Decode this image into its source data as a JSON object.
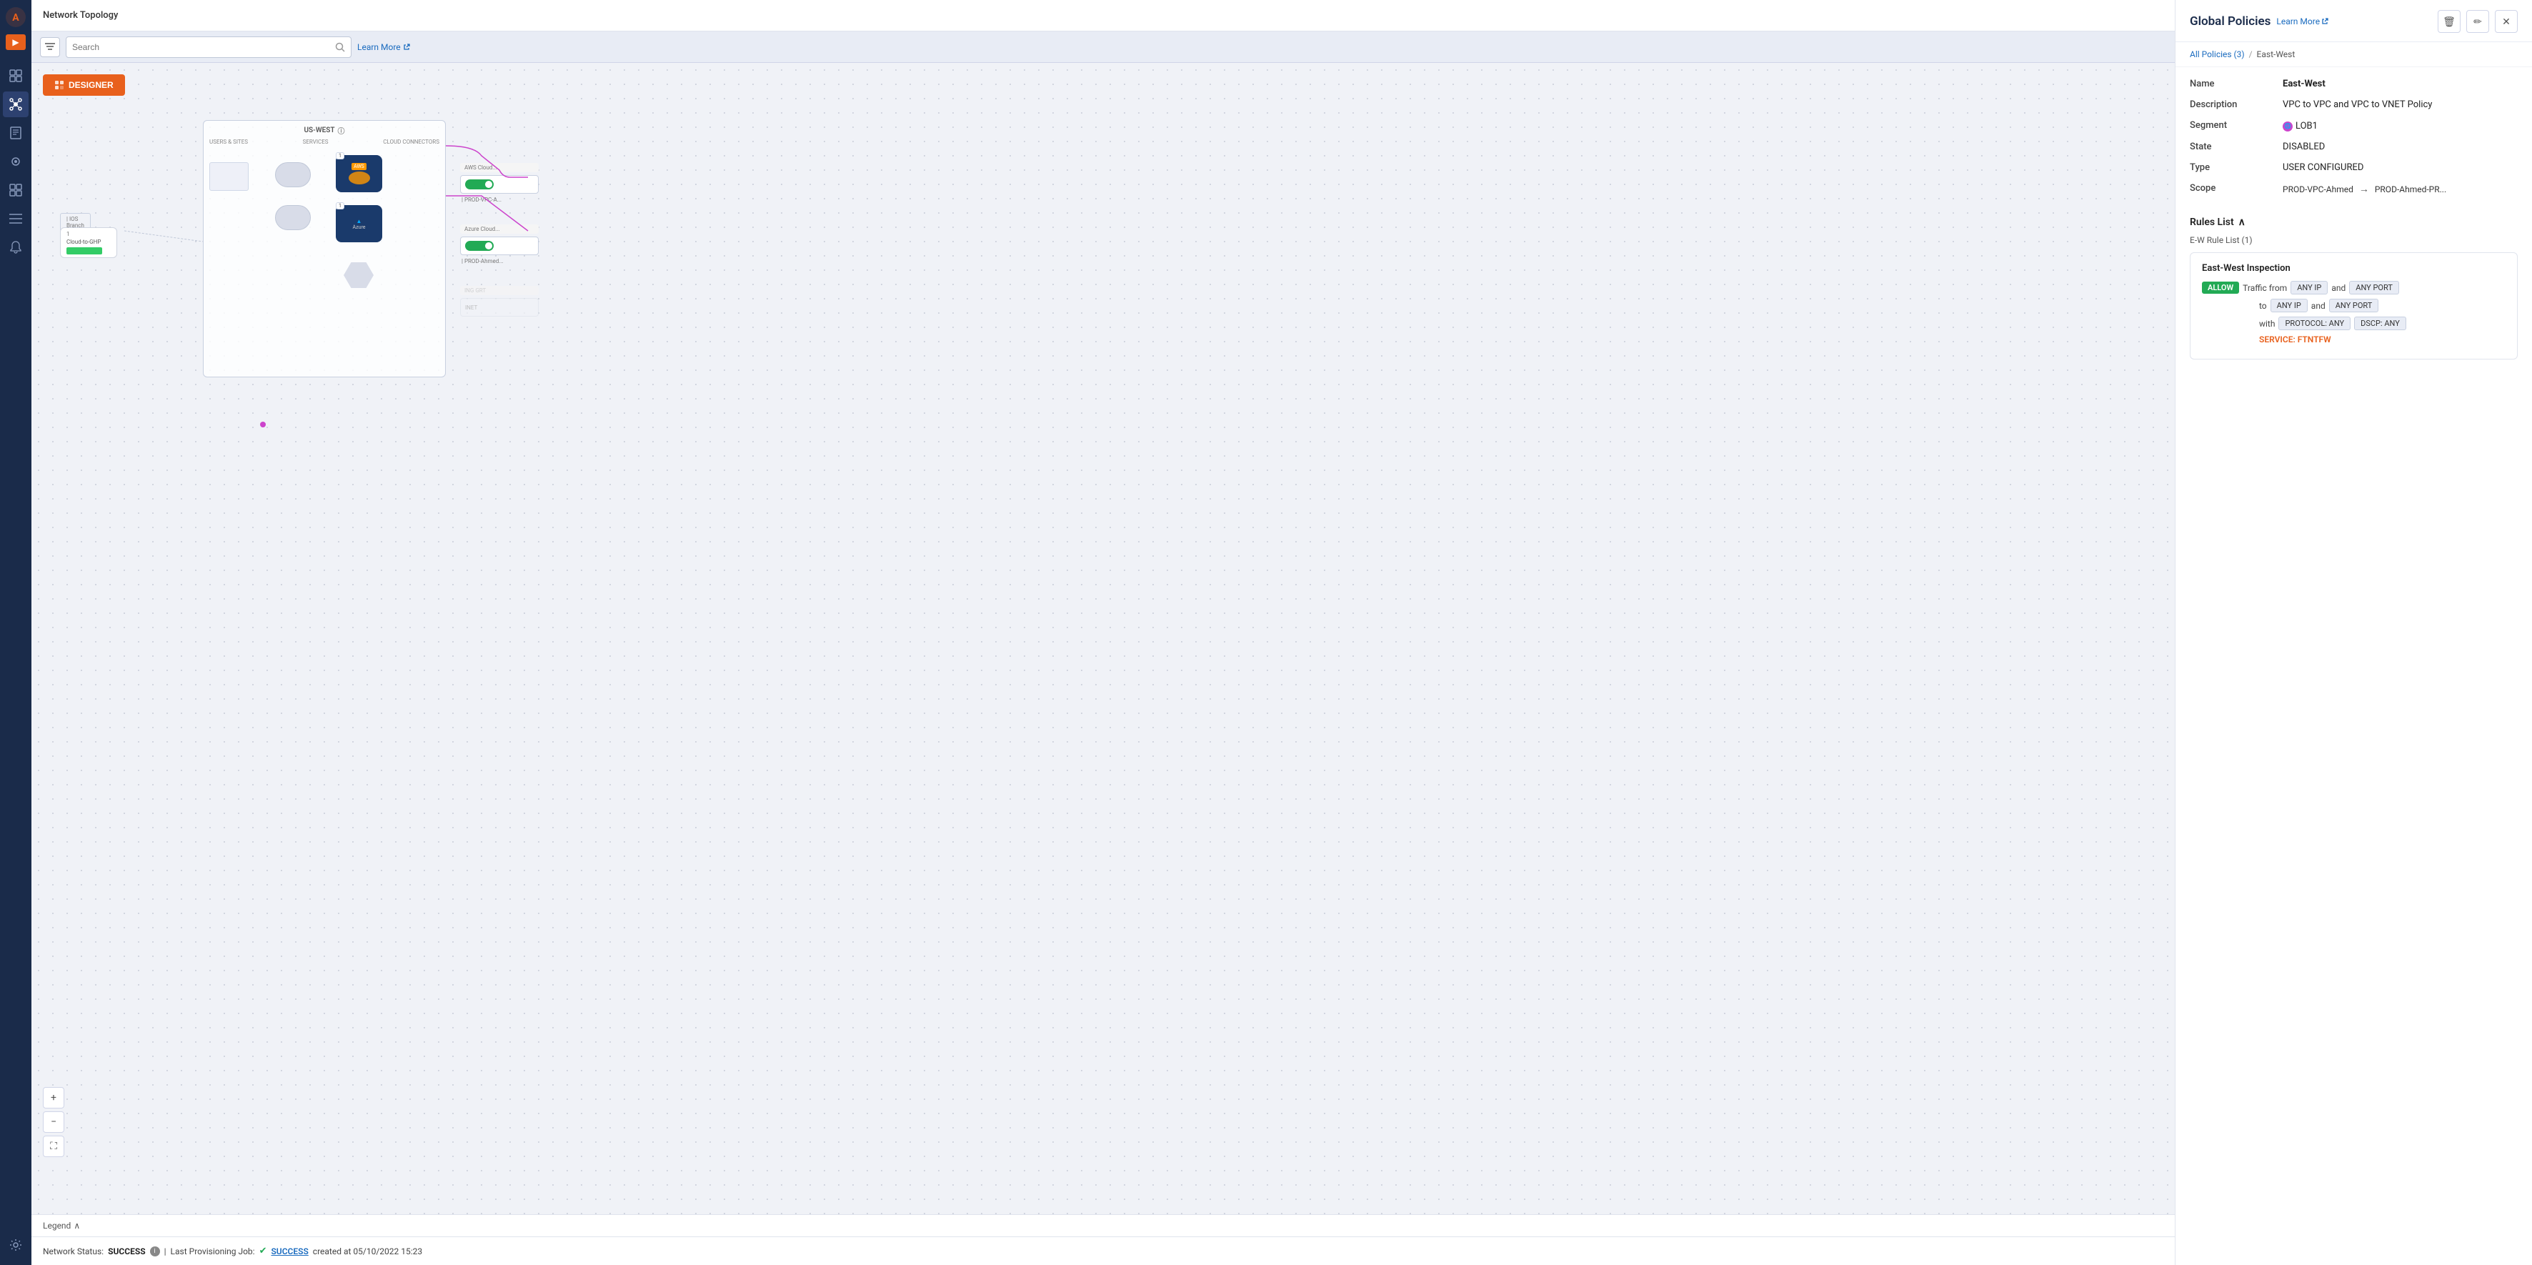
{
  "app": {
    "title": "Network Topology"
  },
  "sidebar": {
    "items": [
      {
        "id": "dashboard",
        "icon": "⊞",
        "active": false
      },
      {
        "id": "topology",
        "icon": "🔗",
        "active": true
      },
      {
        "id": "docs",
        "icon": "📄",
        "active": false
      },
      {
        "id": "plugins",
        "icon": "🔧",
        "active": false
      },
      {
        "id": "puzzle",
        "icon": "🧩",
        "active": false
      },
      {
        "id": "settings-list",
        "icon": "☰",
        "active": false
      },
      {
        "id": "bell",
        "icon": "🔔",
        "active": false
      }
    ],
    "bottom": [
      {
        "id": "settings",
        "icon": "⚙"
      }
    ]
  },
  "toolbar": {
    "search_placeholder": "Search",
    "learn_more_label": "Learn More",
    "designer_label": "DESIGNER"
  },
  "diagram": {
    "region_label": "US-WEST",
    "columns": [
      "USERS & SITES",
      "SERVICES",
      "CLOUD CONNECTORS"
    ],
    "info_icon": "ⓘ"
  },
  "zoom": {
    "plus_label": "+",
    "minus_label": "−",
    "fit_label": "⛶"
  },
  "legend": {
    "label": "Legend",
    "chevron": "∧"
  },
  "status_bar": {
    "network_status_label": "Network Status:",
    "network_status_value": "SUCCESS",
    "divider": "|",
    "provisioning_label": "Last Provisioning Job:",
    "provisioning_status": "SUCCESS",
    "provisioning_date": "created at 05/10/2022 15:23"
  },
  "right_panel": {
    "title": "Global Policies",
    "learn_more_label": "Learn More",
    "breadcrumb": {
      "all_policies": "All Policies (3)",
      "separator": "/",
      "current": "East-West"
    },
    "details": {
      "name_label": "Name",
      "name_value": "East-West",
      "description_label": "Description",
      "description_value": "VPC to VPC and VPC to VNET Policy",
      "segment_label": "Segment",
      "segment_value": "LOB1",
      "state_label": "State",
      "state_value": "DISABLED",
      "type_label": "Type",
      "type_value": "USER CONFIGURED",
      "scope_label": "Scope",
      "scope_from": "PROD-VPC-Ahmed",
      "scope_to": "PROD-Ahmed-PR...",
      "scope_arrow": "→"
    },
    "rules": {
      "rules_list_label": "Rules List",
      "ew_rule_label": "E-W Rule List (1)",
      "inspection_title": "East-West Inspection",
      "allow_badge": "ALLOW",
      "traffic_from": "Traffic from",
      "any_ip_1": "ANY IP",
      "and_1": "and",
      "any_port_1": "ANY PORT",
      "to_label": "to",
      "any_ip_2": "ANY IP",
      "and_2": "and",
      "any_port_2": "ANY PORT",
      "with_label": "with",
      "protocol": "PROTOCOL: ANY",
      "dscp": "DSCP: ANY",
      "service_label": "SERVICE: FTNTFW"
    },
    "actions": {
      "delete_label": "🗑",
      "edit_label": "✏",
      "close_label": "✕"
    }
  }
}
